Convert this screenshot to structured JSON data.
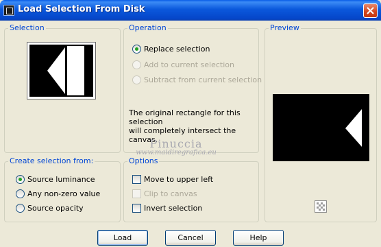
{
  "window": {
    "title": "Load Selection From Disk",
    "close_icon": "close-icon"
  },
  "selection_group": {
    "label": "Selection"
  },
  "operation_group": {
    "label": "Operation",
    "options": [
      {
        "label": "Replace selection",
        "checked": true,
        "enabled": true
      },
      {
        "label": "Add to current selection",
        "checked": false,
        "enabled": false
      },
      {
        "label": "Subtract from current selection",
        "checked": false,
        "enabled": false
      }
    ],
    "info_line1": "The original rectangle for this selection",
    "info_line2": "will completely intersect the canvas."
  },
  "preview_group": {
    "label": "Preview"
  },
  "create_group": {
    "label": "Create selection from:",
    "options": [
      {
        "label": "Source luminance",
        "checked": true
      },
      {
        "label": "Any non-zero value",
        "checked": false
      },
      {
        "label": "Source opacity",
        "checked": false
      }
    ]
  },
  "options_group": {
    "label": "Options",
    "items": [
      {
        "label": "Move to upper left",
        "checked": false,
        "enabled": true
      },
      {
        "label": "Clip to canvas",
        "checked": false,
        "enabled": false
      },
      {
        "label": "Invert selection",
        "checked": false,
        "enabled": true
      }
    ]
  },
  "watermark": {
    "name": "Pinuccia",
    "url": "www.maidiregrafica.eu"
  },
  "buttons": {
    "load": "Load",
    "cancel": "Cancel",
    "help": "Help"
  }
}
